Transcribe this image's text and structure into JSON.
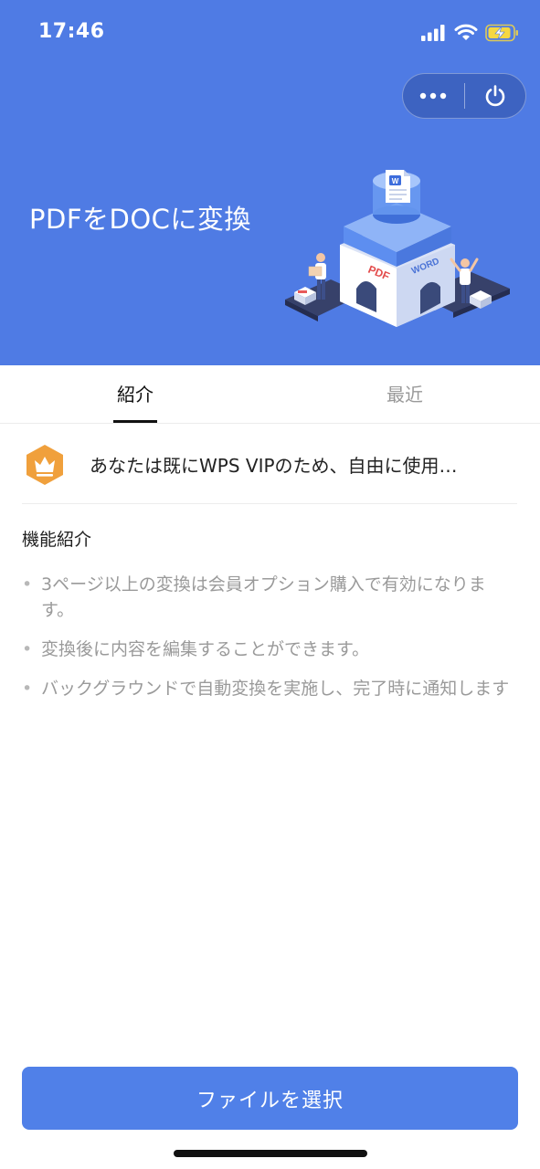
{
  "status_bar": {
    "time": "17:46"
  },
  "hero": {
    "title": "PDFをDOCに変換"
  },
  "illustration": {
    "pdf_label": "PDF",
    "word_label": "WORD",
    "doc_badge": "W"
  },
  "tabs": [
    {
      "label": "紹介",
      "active": true
    },
    {
      "label": "最近",
      "active": false
    }
  ],
  "vip": {
    "text": "あなたは既にWPS VIPのため、自由に使用…"
  },
  "features": {
    "title": "機能紹介",
    "bullet": "•",
    "items": [
      "3ページ以上の変換は会員オプション購入で有効になります。",
      "変換後に内容を編集することができます。",
      "バックグラウンドで自動変換を実施し、完了時に通知します"
    ]
  },
  "primary_button": {
    "label": "ファイルを選択"
  },
  "colors": {
    "header_bg": "#4f7be4",
    "button_bg": "#5080e8",
    "vip_badge": "#f0a03c",
    "battery_fill": "#f5d742"
  },
  "icons": [
    "signal-icon",
    "wifi-icon",
    "battery-charging-icon",
    "more-icon",
    "power-icon",
    "crown-icon"
  ]
}
